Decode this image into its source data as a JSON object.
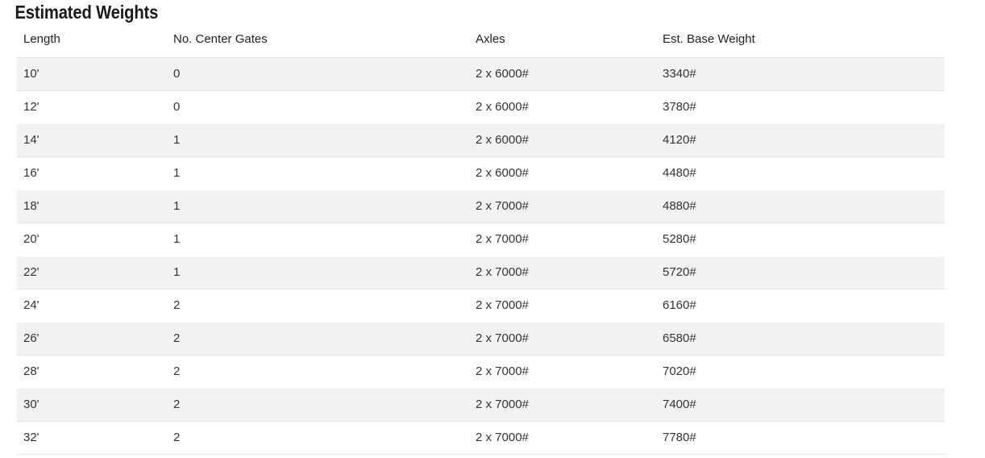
{
  "section": {
    "title": "Estimated Weights"
  },
  "table": {
    "columns": [
      {
        "key": "length",
        "label": "Length"
      },
      {
        "key": "center_gates",
        "label": "No. Center Gates"
      },
      {
        "key": "axles",
        "label": "Axles"
      },
      {
        "key": "base_weight",
        "label": "Est. Base Weight"
      }
    ],
    "rows": [
      {
        "length": "10'",
        "center_gates": "0",
        "axles": "2 x 6000#",
        "base_weight": "3340#"
      },
      {
        "length": "12'",
        "center_gates": "0",
        "axles": "2 x 6000#",
        "base_weight": "3780#"
      },
      {
        "length": "14'",
        "center_gates": "1",
        "axles": "2 x 6000#",
        "base_weight": "4120#"
      },
      {
        "length": "16'",
        "center_gates": "1",
        "axles": "2 x 6000#",
        "base_weight": "4480#"
      },
      {
        "length": "18'",
        "center_gates": "1",
        "axles": "2 x 7000#",
        "base_weight": "4880#"
      },
      {
        "length": "20'",
        "center_gates": "1",
        "axles": "2 x 7000#",
        "base_weight": "5280#"
      },
      {
        "length": "22'",
        "center_gates": "1",
        "axles": "2 x 7000#",
        "base_weight": "5720#"
      },
      {
        "length": "24'",
        "center_gates": "2",
        "axles": "2 x 7000#",
        "base_weight": "6160#"
      },
      {
        "length": "26'",
        "center_gates": "2",
        "axles": "2 x 7000#",
        "base_weight": "6580#"
      },
      {
        "length": "28'",
        "center_gates": "2",
        "axles": "2 x 7000#",
        "base_weight": "7020#"
      },
      {
        "length": "30'",
        "center_gates": "2",
        "axles": "2 x 7000#",
        "base_weight": "7400#"
      },
      {
        "length": "32'",
        "center_gates": "2",
        "axles": "2 x 7000#",
        "base_weight": "7780#"
      }
    ]
  },
  "colors": {
    "stripe": "#f2f2f2",
    "row_border": "#e3e3e3",
    "heading_text": "#1a1a1a",
    "body_text": "#333333",
    "background": "#ffffff"
  }
}
